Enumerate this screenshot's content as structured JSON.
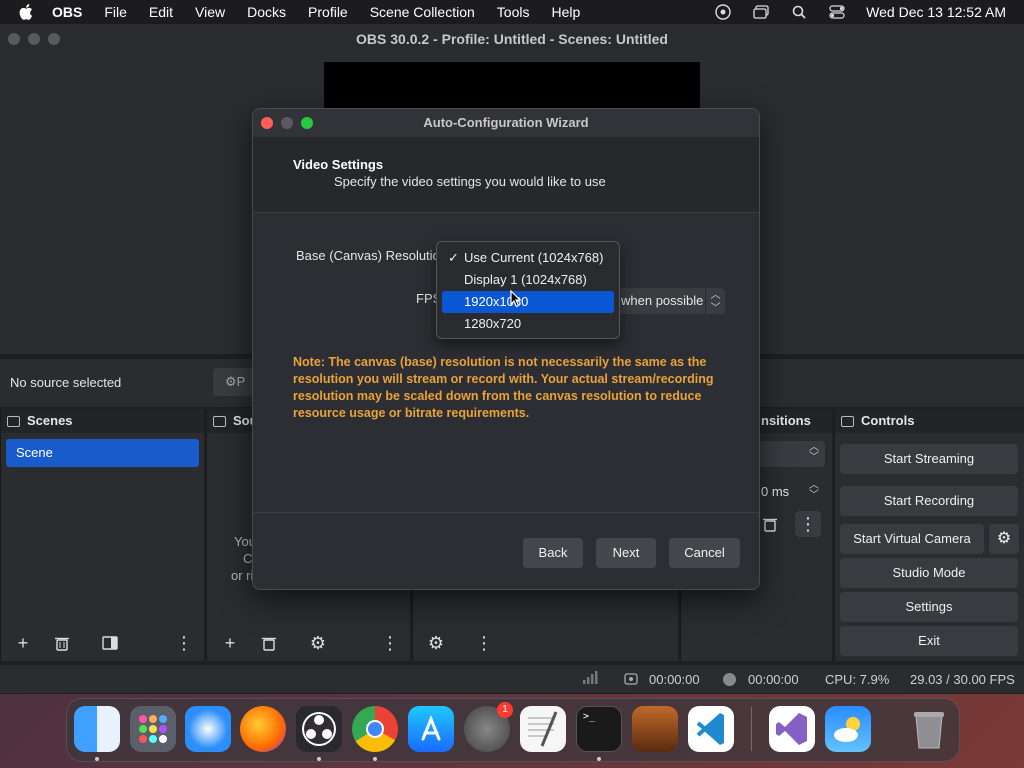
{
  "menubar": {
    "app_name": "OBS",
    "items": [
      "File",
      "Edit",
      "View",
      "Docks",
      "Profile",
      "Scene Collection",
      "Tools",
      "Help"
    ],
    "clock": "Wed Dec 13  12:52 AM"
  },
  "window": {
    "title": "OBS 30.0.2 - Profile: Untitled - Scenes: Untitled"
  },
  "source_bar": {
    "no_source": "No source selected",
    "properties_partial": "P"
  },
  "panels": {
    "scenes": {
      "title": "Scenes",
      "items": [
        "Scene"
      ]
    },
    "sources": {
      "title": "Sou",
      "hint_lines": [
        "You",
        "C",
        "or ri"
      ]
    },
    "transitions": {
      "title": "nsitions",
      "duration": "0 ms"
    },
    "controls": {
      "title": "Controls",
      "buttons": [
        "Start Streaming",
        "Start Recording",
        "Start Virtual Camera",
        "Studio Mode",
        "Settings",
        "Exit"
      ]
    }
  },
  "statusbar": {
    "stream_time": "00:00:00",
    "rec_time": "00:00:00",
    "cpu": "CPU: 7.9%",
    "fps": "29.03 / 30.00 FPS"
  },
  "dialog": {
    "title": "Auto-Configuration Wizard",
    "heading": "Video Settings",
    "subheading": "Specify the video settings you would like to use",
    "resolution_label": "Base (Canvas) Resolution",
    "fps_label": "FPS",
    "fps_value": "when possible",
    "note": "Note: The canvas (base) resolution is not necessarily the same as the resolution you will stream or record with. Your actual stream/recording resolution may be scaled down from the canvas resolution to reduce resource usage or bitrate requirements.",
    "buttons": {
      "back": "Back",
      "next": "Next",
      "cancel": "Cancel"
    },
    "resolution_options": [
      "Use Current (1024x768)",
      "Display 1 (1024x768)",
      "1920x1080",
      "1280x720"
    ],
    "checked_option": "Use Current (1024x768)",
    "highlighted_option": "1920x1080",
    "check_glyph": "✓"
  },
  "dock": {
    "badge": "1",
    "apps": [
      "finder-icon",
      "launchpad-icon",
      "safari-icon",
      "firefox-icon",
      "obs-icon",
      "chrome-icon",
      "app-store-icon",
      "system-settings-icon",
      "textedit-icon",
      "terminal-icon",
      "garageband-icon",
      "vscode-icon",
      "visual-studio-icon",
      "weather-icon",
      "trash-icon"
    ]
  },
  "colors": {
    "accent": "#1a5bcc",
    "highlight": "#0a57d6",
    "note": "#e8a33a",
    "close": "#ff5f57",
    "minimize": "#5a5a5e",
    "maximize": "#28c840"
  }
}
